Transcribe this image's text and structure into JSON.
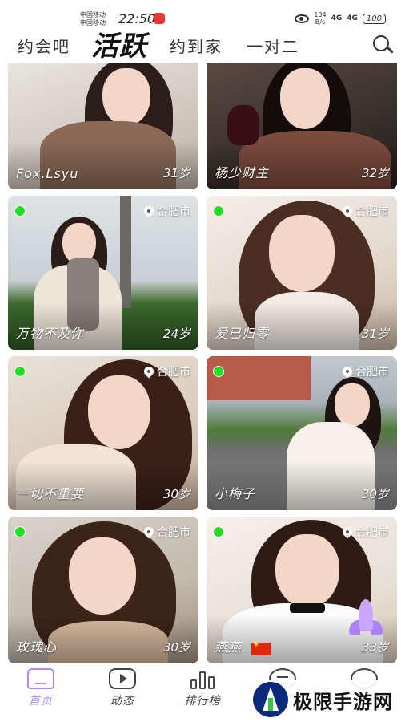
{
  "status_bar": {
    "carrier_1": "中国移动",
    "carrier_2": "中国移动",
    "time": "22:50",
    "net_speed_value": "134",
    "net_speed_unit": "B/s",
    "signal_1": "4G",
    "signal_2": "4G",
    "battery": "100"
  },
  "top_tabs": {
    "tab_1": "约会吧",
    "tab_2": "活跃",
    "tab_3": "约到家",
    "tab_4": "一对二",
    "active": "活跃"
  },
  "cards": [
    {
      "name": "Fox.Lsyu",
      "age": "31岁",
      "location": "",
      "online": false
    },
    {
      "name": "杨少财主",
      "age": "32岁",
      "location": "",
      "online": false
    },
    {
      "name": "万物不及你",
      "age": "24岁",
      "location": "合肥市",
      "online": true
    },
    {
      "name": "爱已归零",
      "age": "31岁",
      "location": "合肥市",
      "online": true
    },
    {
      "name": "一切不重要",
      "age": "30岁",
      "location": "合肥市",
      "online": true
    },
    {
      "name": "小梅子",
      "age": "30岁",
      "location": "合肥市",
      "online": true
    },
    {
      "name": "玫瑰心",
      "age": "30岁",
      "location": "合肥市",
      "online": true
    },
    {
      "name": "燕燕",
      "age": "33岁",
      "location": "合肥市",
      "online": true
    }
  ],
  "bottom_nav": {
    "home": "首页",
    "feed": "动态",
    "ranking": "排行榜",
    "active_color": "#b388ff"
  },
  "watermark": {
    "text": "极限手游网"
  },
  "colors": {
    "online": "#22dd22",
    "accent": "#b388ff"
  }
}
